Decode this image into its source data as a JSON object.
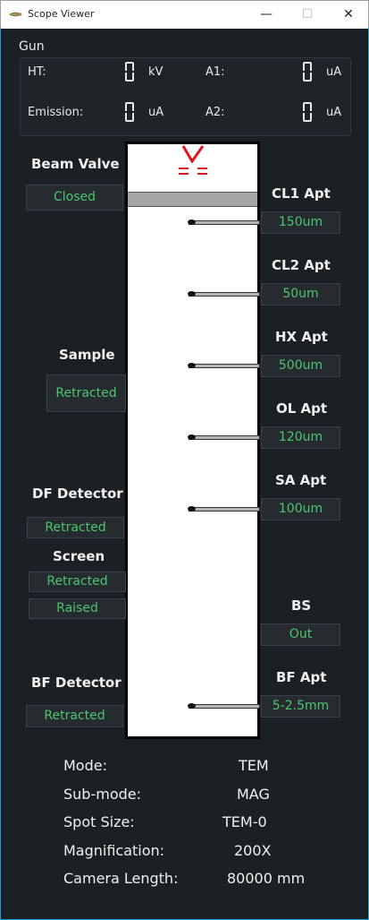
{
  "window": {
    "title": "Scope Viewer",
    "minimize": "—",
    "maximize": "☐",
    "close": "✕"
  },
  "gun": {
    "section_label": "Gun",
    "ht_label": "HT:",
    "ht_unit": "kV",
    "a1_label": "A1:",
    "a1_unit": "uA",
    "emission_label": "Emission:",
    "emission_unit": "uA",
    "a2_label": "A2:",
    "a2_unit": "uA"
  },
  "left": {
    "beam_valve": {
      "label": "Beam Valve",
      "value": "Closed"
    },
    "sample": {
      "label": "Sample",
      "value": "Retracted"
    },
    "df_detector": {
      "label": "DF Detector",
      "value": "Retracted"
    },
    "screen": {
      "label": "Screen",
      "value1": "Retracted",
      "value2": "Raised"
    },
    "bf_detector": {
      "label": "BF Detector",
      "value": "Retracted"
    }
  },
  "right": {
    "cl1": {
      "label": "CL1 Apt",
      "value": "150um"
    },
    "cl2": {
      "label": "CL2 Apt",
      "value": "50um"
    },
    "hx": {
      "label": "HX Apt",
      "value": "500um"
    },
    "ol": {
      "label": "OL Apt",
      "value": "120um"
    },
    "sa": {
      "label": "SA Apt",
      "value": "100um"
    },
    "bs": {
      "label": "BS",
      "value": "Out"
    },
    "bf": {
      "label": "BF Apt",
      "value": "5-2.5mm"
    }
  },
  "info": {
    "mode_label": "Mode:",
    "mode_value": "TEM",
    "submode_label": "Sub-mode:",
    "submode_value": "MAG",
    "spot_label": "Spot Size:",
    "spot_value": "TEM-0",
    "mag_label": "Magnification:",
    "mag_value": "200X",
    "camera_label": "Camera Length:",
    "camera_value": "80000 mm"
  },
  "colors": {
    "value_text": "#4cc46f",
    "gun_symbol": "#e0141e",
    "window_border": "#2a9bd2"
  }
}
